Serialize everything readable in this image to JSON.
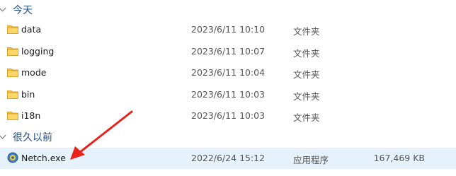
{
  "groups": [
    {
      "title": "今天",
      "items": [
        {
          "name": "data",
          "date": "2023/6/11 10:10",
          "type": "文件夹",
          "size": ""
        },
        {
          "name": "logging",
          "date": "2023/6/11 10:07",
          "type": "文件夹",
          "size": ""
        },
        {
          "name": "mode",
          "date": "2023/6/11 10:04",
          "type": "文件夹",
          "size": ""
        },
        {
          "name": "bin",
          "date": "2023/6/11 10:03",
          "type": "文件夹",
          "size": ""
        },
        {
          "name": "i18n",
          "date": "2023/6/11 10:03",
          "type": "文件夹",
          "size": ""
        }
      ]
    },
    {
      "title": "很久以前",
      "items": [
        {
          "name": "Netch.exe",
          "date": "2022/6/24 15:12",
          "type": "应用程序",
          "size": "167,469 KB"
        }
      ]
    }
  ],
  "colors": {
    "group_header": "#1f4e8c",
    "selected_row": "#e5f1fb",
    "arrow": "#e8221b",
    "folder": "#f5c34b"
  },
  "icons": {
    "folder": "folder-icon",
    "app": "netch-app-icon",
    "group_toggle": "chevron-down-icon"
  }
}
